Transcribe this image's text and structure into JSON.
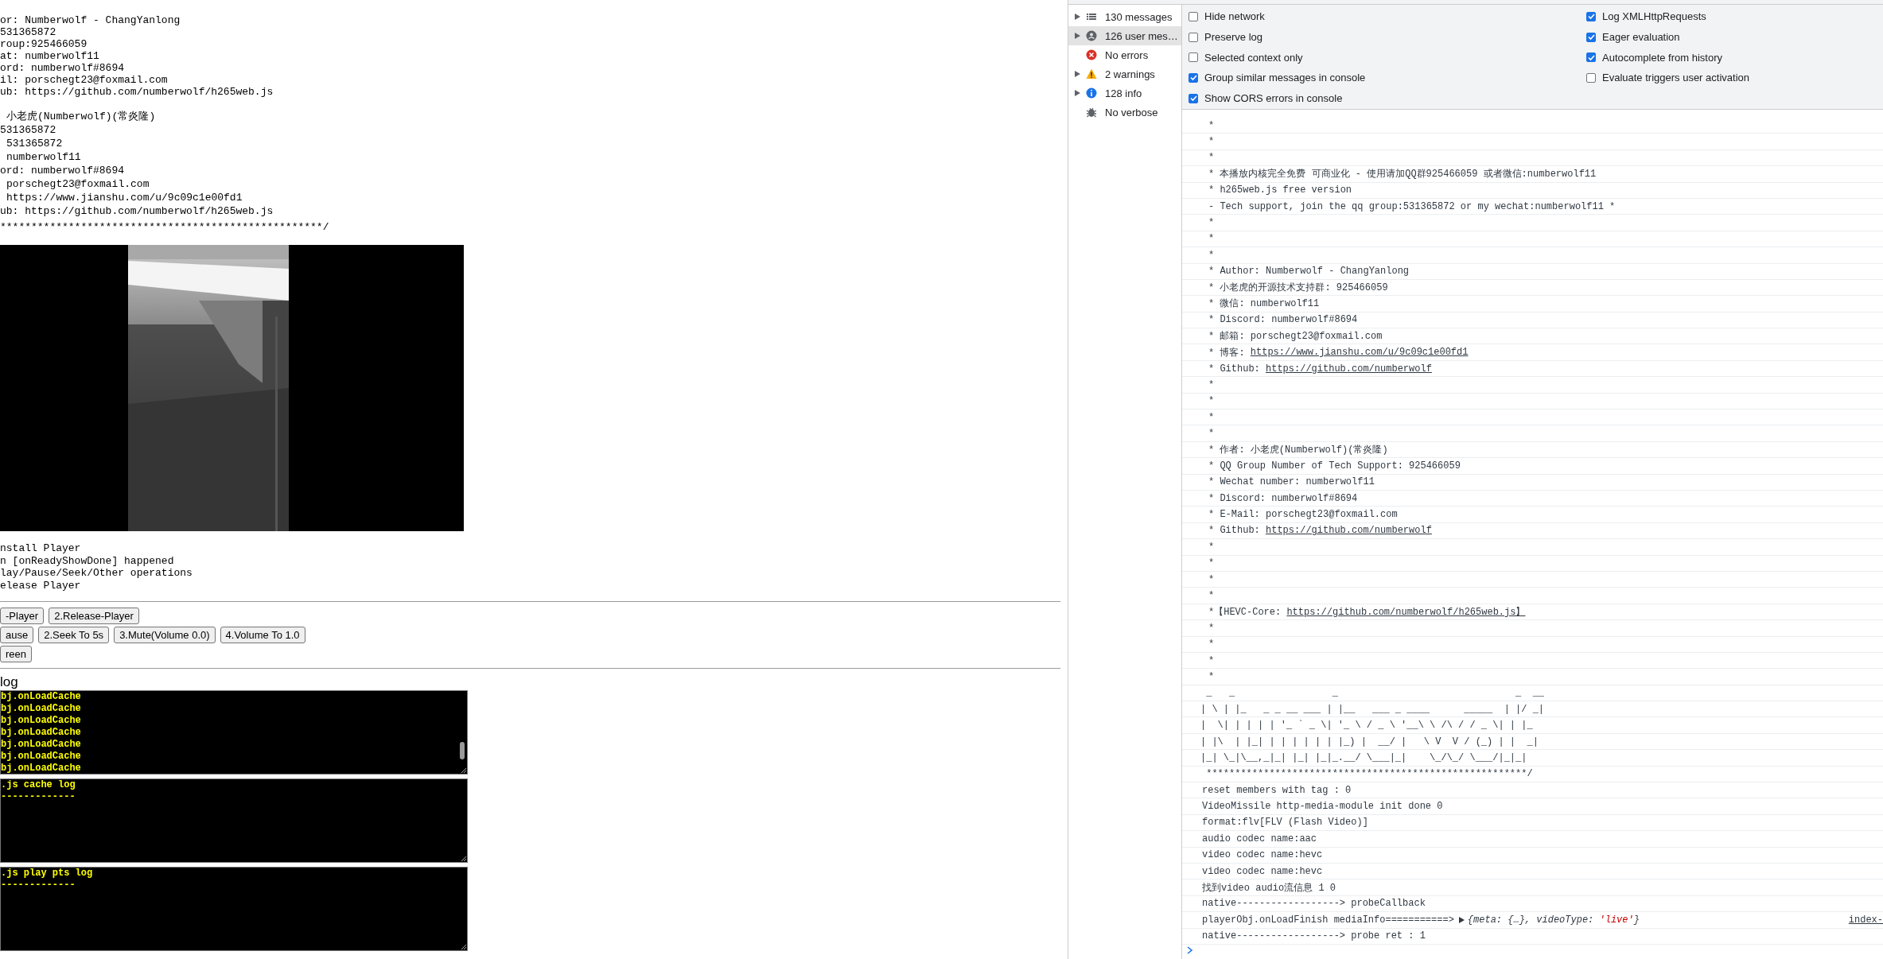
{
  "page": {
    "intro_lines": [
      "or: Numberwolf - ChangYanlong",
      "531365872",
      "roup:925466059",
      "at: numberwolf11",
      "ord: numberwolf#8694",
      "il: porschegt23@foxmail.com",
      "ub: https://github.com/numberwolf/h265web.js"
    ],
    "author_lines": [
      {
        "text": "小老虎(Numberwolf)(常炎隆)",
        "indented": true
      },
      {
        "text": "531365872",
        "indented": false
      },
      {
        "text": "531365872",
        "indented": true
      },
      {
        "text": "numberwolf11",
        "indented": true
      },
      {
        "text": "ord: numberwolf#8694",
        "indented": false
      },
      {
        "text": "porschegt23@foxmail.com",
        "indented": true
      },
      {
        "text": "https://www.jianshu.com/u/9c09c1e00fd1",
        "indented": true
      },
      {
        "text": "ub: https://github.com/numberwolf/h265web.js",
        "indented": false
      }
    ],
    "closing": "****************************************************/",
    "video": {
      "kind": "picture"
    },
    "steps": [
      "nstall Player",
      "n [onReadyShowDone] happened",
      "lay/Pause/Seek/Other operations",
      "elease Player"
    ],
    "button_rows": [
      [
        "-Player",
        "2.Release-Player"
      ],
      [
        "ause",
        "2.Seek To 5s",
        "3.Mute(Volume 0.0)",
        "4.Volume To 1.0"
      ],
      [
        "reen"
      ]
    ],
    "log_title": "log",
    "logs": [
      {
        "lines": [
          "bj.onLoadCache",
          "bj.onLoadCache",
          "bj.onLoadCache",
          "bj.onLoadCache",
          "bj.onLoadCache",
          "bj.onLoadCache",
          "bj.onLoadCache"
        ],
        "scrollable": true
      },
      {
        "lines": [
          ".js cache log",
          "-------------"
        ],
        "scrollable": false
      },
      {
        "lines": [
          ".js play pts log",
          "-------------"
        ],
        "scrollable": false
      }
    ]
  },
  "devtools": {
    "sidebar": [
      {
        "label": "130 messages",
        "kind": "messages",
        "expandable": true,
        "selected": false
      },
      {
        "label": "126 user mes…",
        "kind": "user",
        "expandable": true,
        "selected": true
      },
      {
        "label": "No errors",
        "kind": "error",
        "expandable": false,
        "selected": false
      },
      {
        "label": "2 warnings",
        "kind": "warning",
        "expandable": true,
        "selected": false
      },
      {
        "label": "128 info",
        "kind": "info",
        "expandable": true,
        "selected": false
      },
      {
        "label": "No verbose",
        "kind": "verbose",
        "expandable": false,
        "selected": false
      }
    ],
    "settings": {
      "left": [
        {
          "label": "Hide network",
          "checked": false
        },
        {
          "label": "Preserve log",
          "checked": false
        },
        {
          "label": "Selected context only",
          "checked": false
        },
        {
          "label": "Group similar messages in console",
          "checked": true
        },
        {
          "label": "Show CORS errors in console",
          "checked": true
        }
      ],
      "right": [
        {
          "label": "Log XMLHttpRequests",
          "checked": true
        },
        {
          "label": "Eager evaluation",
          "checked": true
        },
        {
          "label": "Autocomplete from history",
          "checked": true
        },
        {
          "label": "Evaluate triggers user activation",
          "checked": false
        }
      ]
    },
    "console": [
      {
        "kind": "banner",
        "text": "*"
      },
      {
        "kind": "banner",
        "text": "*"
      },
      {
        "kind": "banner",
        "text": "*"
      },
      {
        "kind": "banner",
        "text": "* 本播放内核完全免费 可商业化 - 使用请加QQ群925466059 或者微信:numberwolf11"
      },
      {
        "kind": "banner",
        "text": "* h265web.js free version"
      },
      {
        "kind": "banner",
        "text": "- Tech support, join the qq group:531365872 or my wechat:numberwolf11 *"
      },
      {
        "kind": "banner",
        "text": "*"
      },
      {
        "kind": "banner",
        "text": "*"
      },
      {
        "kind": "banner",
        "text": "*"
      },
      {
        "kind": "banner",
        "text": "* Author: Numberwolf - ChangYanlong"
      },
      {
        "kind": "banner",
        "text": "* 小老虎的开源技术支持群: 925466059"
      },
      {
        "kind": "banner",
        "text": "* 微信: numberwolf11"
      },
      {
        "kind": "banner",
        "text": "* Discord: numberwolf#8694"
      },
      {
        "kind": "banner",
        "text": "* 邮箱: porschegt23@foxmail.com"
      },
      {
        "kind": "banner",
        "text": "* 博客:",
        "link": "https://www.jianshu.com/u/9c09c1e00fd1"
      },
      {
        "kind": "banner",
        "text": "* Github:",
        "link": "https://github.com/numberwolf"
      },
      {
        "kind": "banner",
        "text": "*"
      },
      {
        "kind": "banner",
        "text": "*"
      },
      {
        "kind": "banner",
        "text": "*"
      },
      {
        "kind": "banner",
        "text": "*"
      },
      {
        "kind": "banner",
        "text": "* 作者: 小老虎(Numberwolf)(常炎隆)"
      },
      {
        "kind": "banner",
        "text": "* QQ Group Number of Tech Support: 925466059"
      },
      {
        "kind": "banner",
        "text": "* Wechat number: numberwolf11"
      },
      {
        "kind": "banner",
        "text": "* Discord: numberwolf#8694"
      },
      {
        "kind": "banner",
        "text": "* E-Mail: porschegt23@foxmail.com"
      },
      {
        "kind": "banner",
        "text": "* Github:",
        "link": "https://github.com/numberwolf"
      },
      {
        "kind": "banner",
        "text": "*"
      },
      {
        "kind": "banner",
        "text": "*"
      },
      {
        "kind": "banner",
        "text": "*"
      },
      {
        "kind": "banner",
        "text": "*"
      },
      {
        "kind": "banner",
        "text": "*【HEVC-Core:",
        "link": "https://github.com/numberwolf/h265web.js】"
      },
      {
        "kind": "banner",
        "text": "*"
      },
      {
        "kind": "banner",
        "text": "*"
      },
      {
        "kind": "banner",
        "text": "*"
      },
      {
        "kind": "banner",
        "text": "*"
      },
      {
        "kind": "art",
        "text": " _   _                 _                               _  __"
      },
      {
        "kind": "art",
        "text": "| \\ | |_   _ _ __ ___ | |__   ___ _ ____      _____  | |/ _|"
      },
      {
        "kind": "art",
        "text": "|  \\| | | | | '_ ` _ \\| '_ \\ / _ \\ '__\\ \\ /\\ / / _ \\| | |_"
      },
      {
        "kind": "art",
        "text": "| |\\  | |_| | | | | | | |_) |  __/ |   \\ V  V / (_) | |  _|"
      },
      {
        "kind": "art",
        "text": "|_| \\_|\\__,_|_| |_| |_|_.__/ \\___|_|    \\_/\\_/ \\___/|_|_|"
      },
      {
        "kind": "art",
        "text": " ********************************************************/"
      },
      {
        "kind": "log",
        "text": "reset members with tag : 0"
      },
      {
        "kind": "log",
        "text": "VideoMissile http-media-module init done 0"
      },
      {
        "kind": "log",
        "text": "format:flv[FLV (Flash Video)]"
      },
      {
        "kind": "log",
        "text": "audio codec name:aac"
      },
      {
        "kind": "log",
        "text": "video codec name:hevc"
      },
      {
        "kind": "log",
        "text": "video codec name:hevc"
      },
      {
        "kind": "log",
        "text": "找到video audio流信息 1 0"
      },
      {
        "kind": "log",
        "text": "native------------------> probeCallback"
      },
      {
        "kind": "object",
        "text": "playerObj.onLoadFinish mediaInfo===========>",
        "preview_start": "{meta: {…}, videoType: ",
        "preview_value": "'live'",
        "preview_end": "}",
        "source": "index-"
      },
      {
        "kind": "log",
        "text": "native------------------> probe ret : 1"
      }
    ]
  }
}
